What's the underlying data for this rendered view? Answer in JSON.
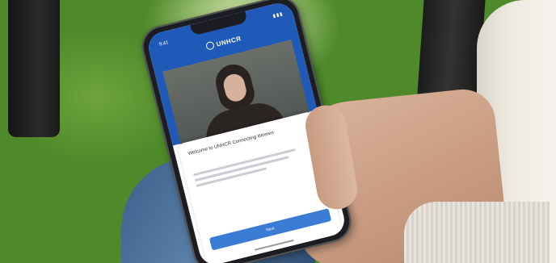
{
  "photo": {
    "subject": "hand holding smartphone over grass",
    "colors": {
      "grass": "#5a942e",
      "phone_screen_header": "#1f5ab8",
      "button": "#3a7bd5",
      "jeans": "#4a6f98"
    }
  },
  "app": {
    "logo_text": "UNHCR",
    "status_time": "9:41",
    "card_title": "Welcome to UNHCR Connecting Women",
    "button_label": "Next"
  },
  "icons": {
    "logo": "unhcr-logo-icon",
    "signal": "signal-icon"
  }
}
